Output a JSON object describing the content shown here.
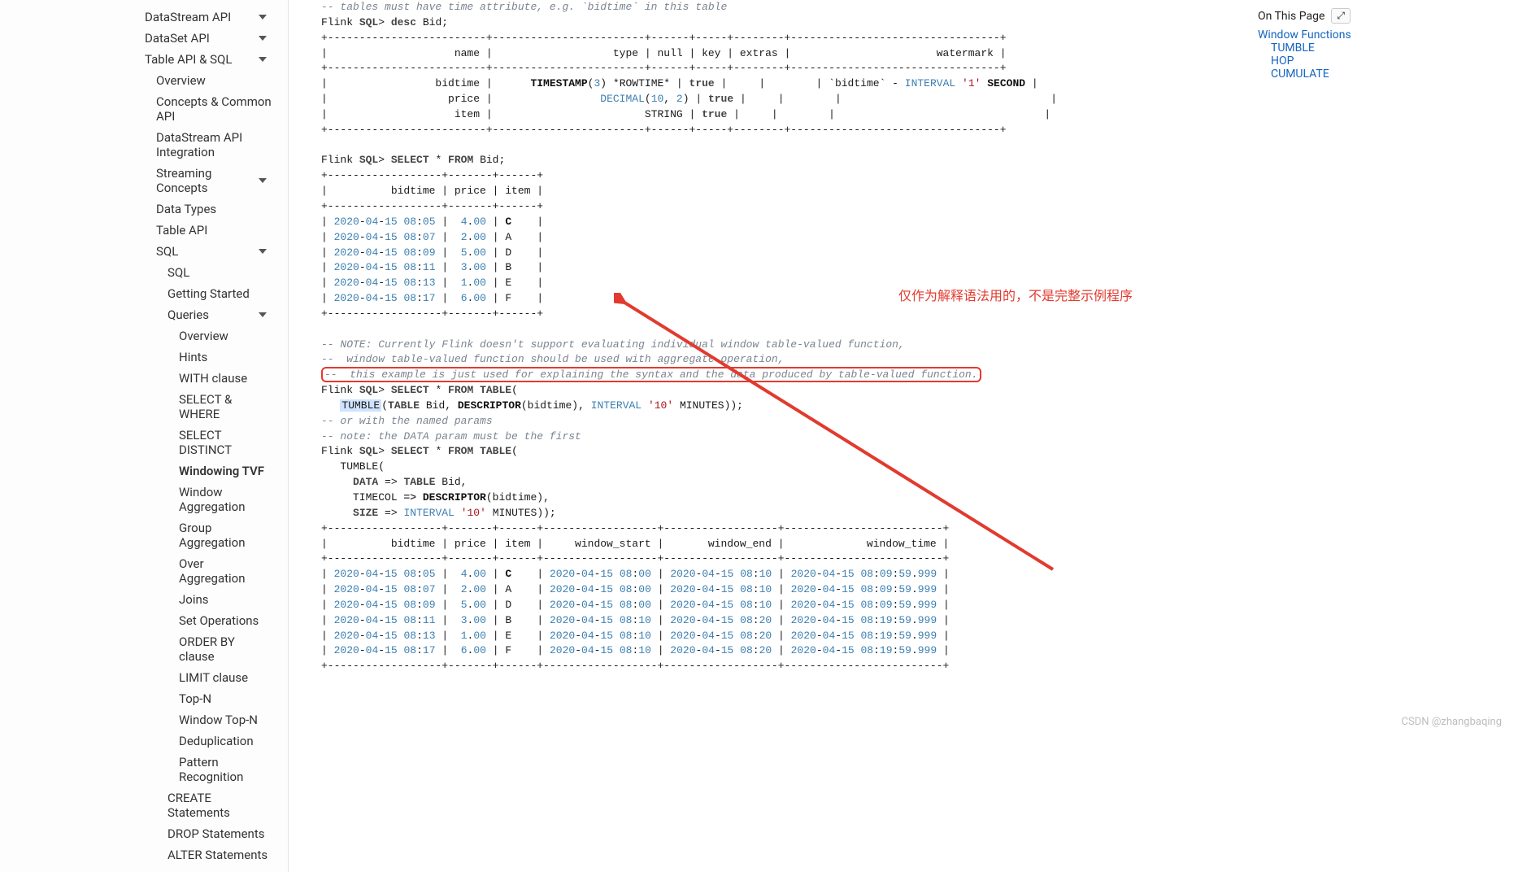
{
  "sidebar": {
    "items": [
      {
        "label": "DataStream API",
        "lvl": 1,
        "caret": true
      },
      {
        "label": "DataSet API",
        "lvl": 1,
        "caret": true
      },
      {
        "label": "Table API & SQL",
        "lvl": 1,
        "caret": true
      },
      {
        "label": "Overview",
        "lvl": 2
      },
      {
        "label": "Concepts & Common API",
        "lvl": 2
      },
      {
        "label": "DataStream API Integration",
        "lvl": 2
      },
      {
        "label": "Streaming Concepts",
        "lvl": 2,
        "caret": true
      },
      {
        "label": "Data Types",
        "lvl": 2
      },
      {
        "label": "Table API",
        "lvl": 2
      },
      {
        "label": "SQL",
        "lvl": 2,
        "caret": true
      },
      {
        "label": "SQL",
        "lvl": 3
      },
      {
        "label": "Getting Started",
        "lvl": 3
      },
      {
        "label": "Queries",
        "lvl": 3,
        "caret": true
      },
      {
        "label": "Overview",
        "lvl": 4
      },
      {
        "label": "Hints",
        "lvl": 4
      },
      {
        "label": "WITH clause",
        "lvl": 4
      },
      {
        "label": "SELECT & WHERE",
        "lvl": 4
      },
      {
        "label": "SELECT DISTINCT",
        "lvl": 4
      },
      {
        "label": "Windowing TVF",
        "lvl": 4,
        "active": true
      },
      {
        "label": "Window Aggregation",
        "lvl": 4
      },
      {
        "label": "Group Aggregation",
        "lvl": 4
      },
      {
        "label": "Over Aggregation",
        "lvl": 4
      },
      {
        "label": "Joins",
        "lvl": 4
      },
      {
        "label": "Set Operations",
        "lvl": 4
      },
      {
        "label": "ORDER BY clause",
        "lvl": 4
      },
      {
        "label": "LIMIT clause",
        "lvl": 4
      },
      {
        "label": "Top-N",
        "lvl": 4
      },
      {
        "label": "Window Top-N",
        "lvl": 4
      },
      {
        "label": "Deduplication",
        "lvl": 4
      },
      {
        "label": "Pattern Recognition",
        "lvl": 4
      },
      {
        "label": "CREATE Statements",
        "lvl": 3
      },
      {
        "label": "DROP Statements",
        "lvl": 3
      },
      {
        "label": "ALTER Statements",
        "lvl": 3
      }
    ]
  },
  "toc": {
    "title": "On This Page",
    "btn": "⤢",
    "items": [
      {
        "label": "Window Functions",
        "sub": false
      },
      {
        "label": "TUMBLE",
        "sub": true
      },
      {
        "label": "HOP",
        "sub": true
      },
      {
        "label": "CUMULATE",
        "sub": true
      }
    ]
  },
  "code": {
    "c0": "-- tables must have time attribute, e.g. `bidtime` in this table",
    "l1_a": "Flink ",
    "l1_b": "SQL",
    "l1_c": "> ",
    "l1_d": "desc",
    "l1_e": " Bid;",
    "hr1": "+-------------------------+------------------------+------+-----+--------+---------------------------------+",
    "hdr": "|                    name |                   type | null | key | extras |                       watermark |",
    "row_bidtime_a": "|                 bidtime |      ",
    "row_bidtime_b": "TIMESTAMP",
    "row_bidtime_c": "(",
    "row_bidtime_d": "3",
    "row_bidtime_e": ") *ROWTIME* | ",
    "row_bidtime_f": "true",
    "row_bidtime_g": " |     |        | `bidtime` - ",
    "row_bidtime_h": "INTERVAL",
    "row_bidtime_i": " ",
    "row_bidtime_j": "'1'",
    "row_bidtime_k": " ",
    "row_bidtime_l": "SECOND",
    "row_bidtime_m": " |",
    "row_price_a": "|                   price |                 ",
    "row_price_b": "DECIMAL",
    "row_price_c": "(",
    "row_price_d": "10",
    "row_price_e": ", ",
    "row_price_f": "2",
    "row_price_g": ") | ",
    "row_price_h": "true",
    "row_price_i": " |     |        |                                 |",
    "row_item_a": "|                    item |                        STRING | ",
    "row_item_b": "true",
    "row_item_c": " |     |        |                                 |",
    "hr2": "+-------------------------+------------------------+------+-----+--------+---------------------------------+",
    "sel_a": "Flink ",
    "sel_b": "SQL",
    "sel_c": "> ",
    "sel_d": "SELECT",
    "sel_e": " * ",
    "sel_f": "FROM",
    "sel_g": " Bid;",
    "hr3": "+------------------+-------+------+",
    "hdr2": "|          bidtime | price | item |",
    "rows1": [
      [
        "| ",
        "2020",
        "-",
        "04",
        "-",
        "15",
        " ",
        "08",
        ":",
        "05",
        " |  ",
        "4",
        ".",
        "00",
        " | ",
        "C",
        "    |"
      ],
      [
        "| ",
        "2020",
        "-",
        "04",
        "-",
        "15",
        " ",
        "08",
        ":",
        "07",
        " |  ",
        "2",
        ".",
        "00",
        " | A    |"
      ],
      [
        "| ",
        "2020",
        "-",
        "04",
        "-",
        "15",
        " ",
        "08",
        ":",
        "09",
        " |  ",
        "5",
        ".",
        "00",
        " | D    |"
      ],
      [
        "| ",
        "2020",
        "-",
        "04",
        "-",
        "15",
        " ",
        "08",
        ":",
        "11",
        " |  ",
        "3",
        ".",
        "00",
        " | B    |"
      ],
      [
        "| ",
        "2020",
        "-",
        "04",
        "-",
        "15",
        " ",
        "08",
        ":",
        "13",
        " |  ",
        "1",
        ".",
        "00",
        " | E    |"
      ],
      [
        "| ",
        "2020",
        "-",
        "04",
        "-",
        "15",
        " ",
        "08",
        ":",
        "17",
        " |  ",
        "6",
        ".",
        "00",
        " | F    |"
      ]
    ],
    "note1": "-- NOTE: Currently Flink doesn't support evaluating individual window table-valued function,",
    "note2": "--  window table-valued function should be used with aggregate operation,",
    "note3": "--  this example is just used for explaining the syntax and the data produced by table-valued function.",
    "sel2_a": "Flink ",
    "sel2_b": "SQL",
    "sel2_c": "> ",
    "sel2_d": "SELECT",
    "sel2_e": " * ",
    "sel2_f": "FROM",
    "sel2_g": " ",
    "sel2_h": "TABLE",
    "sel2_i": "(",
    "tumble_a": "   ",
    "tumble_b": "TUMBLE",
    "tumble_c": "(",
    "tumble_d": "TABLE",
    "tumble_e": " Bid, ",
    "tumble_f": "DESCRIPTOR",
    "tumble_g": "(bidtime), ",
    "tumble_h": "INTERVAL",
    "tumble_i": " ",
    "tumble_j": "'10'",
    "tumble_k": " MINUTES));",
    "com_or": "-- or with the named params",
    "com_note": "-- note: the DATA param must be the first",
    "sel3_a": "Flink ",
    "sel3_b": "SQL",
    "sel3_c": "> ",
    "sel3_d": "SELECT",
    "sel3_e": " * ",
    "sel3_f": "FROM",
    "sel3_g": " ",
    "sel3_h": "TABLE",
    "sel3_i": "(",
    "tum2": "   TUMBLE(",
    "data_a": "     ",
    "data_b": "DATA",
    "data_c": " => ",
    "data_d": "TABLE",
    "data_e": " Bid,",
    "tcol_a": "     TIMECOL ",
    "tcol_b": "=>",
    "tcol_c": " ",
    "tcol_d": "DESCRIPTOR",
    "tcol_e": "(bidtime),",
    "size_a": "     ",
    "size_b": "SIZE",
    "size_c": " => ",
    "size_d": "INTERVAL",
    "size_e": " ",
    "size_f": "'10'",
    "size_g": " MINUTES));",
    "hr4": "+------------------+-------+------+------------------+------------------+-------------------------+",
    "hdr4": "|          bidtime | price | item |     window_start |       window_end |             window_time |",
    "rows2": [
      [
        "| ",
        "2020",
        "-",
        "04",
        "-",
        "15",
        " ",
        "08",
        ":",
        "05",
        " |  ",
        "4",
        ".",
        "00",
        " | ",
        "C",
        "    | ",
        "2020",
        "-",
        "04",
        "-",
        "15",
        " ",
        "08",
        ":",
        "00",
        " | ",
        "2020",
        "-",
        "04",
        "-",
        "15",
        " ",
        "08",
        ":",
        "10",
        " | ",
        "2020",
        "-",
        "04",
        "-",
        "15",
        " ",
        "08",
        ":",
        "09",
        ":",
        "59",
        ".",
        "999",
        " |"
      ],
      [
        "| ",
        "2020",
        "-",
        "04",
        "-",
        "15",
        " ",
        "08",
        ":",
        "07",
        " |  ",
        "2",
        ".",
        "00",
        " | A    | ",
        "2020",
        "-",
        "04",
        "-",
        "15",
        " ",
        "08",
        ":",
        "00",
        " | ",
        "2020",
        "-",
        "04",
        "-",
        "15",
        " ",
        "08",
        ":",
        "10",
        " | ",
        "2020",
        "-",
        "04",
        "-",
        "15",
        " ",
        "08",
        ":",
        "09",
        ":",
        "59",
        ".",
        "999",
        " |"
      ],
      [
        "| ",
        "2020",
        "-",
        "04",
        "-",
        "15",
        " ",
        "08",
        ":",
        "09",
        " |  ",
        "5",
        ".",
        "00",
        " | D    | ",
        "2020",
        "-",
        "04",
        "-",
        "15",
        " ",
        "08",
        ":",
        "00",
        " | ",
        "2020",
        "-",
        "04",
        "-",
        "15",
        " ",
        "08",
        ":",
        "10",
        " | ",
        "2020",
        "-",
        "04",
        "-",
        "15",
        " ",
        "08",
        ":",
        "09",
        ":",
        "59",
        ".",
        "999",
        " |"
      ],
      [
        "| ",
        "2020",
        "-",
        "04",
        "-",
        "15",
        " ",
        "08",
        ":",
        "11",
        " |  ",
        "3",
        ".",
        "00",
        " | B    | ",
        "2020",
        "-",
        "04",
        "-",
        "15",
        " ",
        "08",
        ":",
        "10",
        " | ",
        "2020",
        "-",
        "04",
        "-",
        "15",
        " ",
        "08",
        ":",
        "20",
        " | ",
        "2020",
        "-",
        "04",
        "-",
        "15",
        " ",
        "08",
        ":",
        "19",
        ":",
        "59",
        ".",
        "999",
        " |"
      ],
      [
        "| ",
        "2020",
        "-",
        "04",
        "-",
        "15",
        " ",
        "08",
        ":",
        "13",
        " |  ",
        "1",
        ".",
        "00",
        " | E    | ",
        "2020",
        "-",
        "04",
        "-",
        "15",
        " ",
        "08",
        ":",
        "10",
        " | ",
        "2020",
        "-",
        "04",
        "-",
        "15",
        " ",
        "08",
        ":",
        "20",
        " | ",
        "2020",
        "-",
        "04",
        "-",
        "15",
        " ",
        "08",
        ":",
        "19",
        ":",
        "59",
        ".",
        "999",
        " |"
      ],
      [
        "| ",
        "2020",
        "-",
        "04",
        "-",
        "15",
        " ",
        "08",
        ":",
        "17",
        " |  ",
        "6",
        ".",
        "00",
        " | F    | ",
        "2020",
        "-",
        "04",
        "-",
        "15",
        " ",
        "08",
        ":",
        "10",
        " | ",
        "2020",
        "-",
        "04",
        "-",
        "15",
        " ",
        "08",
        ":",
        "20",
        " | ",
        "2020",
        "-",
        "04",
        "-",
        "15",
        " ",
        "08",
        ":",
        "19",
        ":",
        "59",
        ".",
        "999",
        " |"
      ]
    ]
  },
  "annotation_text": "仅作为解释语法用的，不是完整示例程序",
  "watermark": "CSDN @zhangbaqing"
}
